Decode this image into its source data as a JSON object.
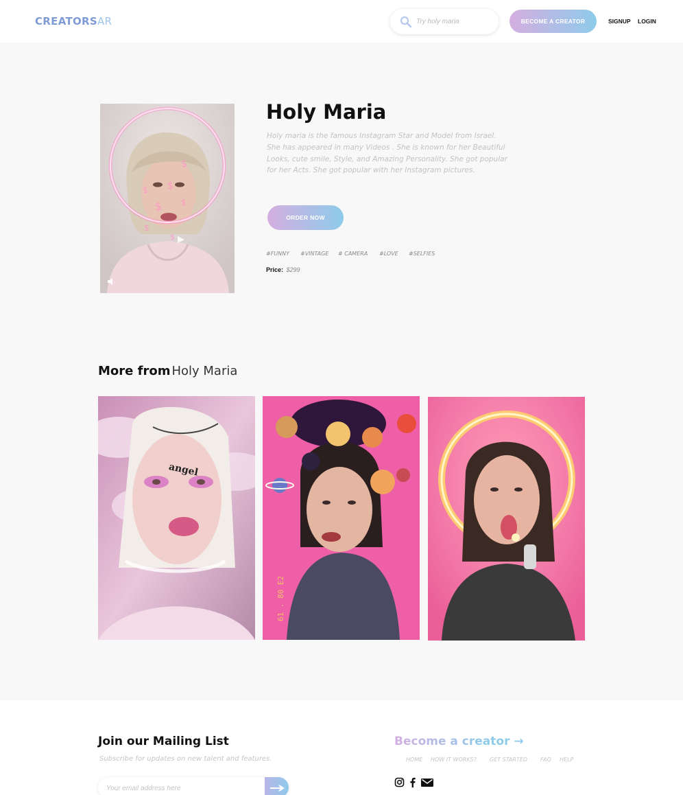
{
  "header": {
    "logo_part1": "CREATORS",
    "logo_part2": "AR",
    "search_placeholder": "Try holy maria",
    "become_creator_label": "BECOME A CREATOR",
    "signup_label": "SIGNUP",
    "login_label": "LOGIN"
  },
  "profile": {
    "name": "Holy Maria",
    "bio": "Holy maria is the famous Instagram Star and Model from Israel. She has appeared in many Videos . She is known for her Beautiful Looks, cute smile, Style, and Amazing Personality. She got popular for her Acts. She got popular with her Instagram pictures.",
    "order_label": "ORDER NOW",
    "tags": [
      "#FUNNY",
      "#VINTAGE",
      "# CAMERA",
      "#LOVE",
      "#SELFIES"
    ],
    "price_label": "Price:",
    "price_value": "$299"
  },
  "more": {
    "title_bold": "More from",
    "title_name": "Holy Maria",
    "card_sticker_text": "angel",
    "card_film_text": "61 . 80 E2"
  },
  "footer": {
    "mailing_title": "Join our Mailing List",
    "mailing_sub": "Subscribe for updates on new talent and features.",
    "email_placeholder": "Your email address here",
    "become_label": "Become a creator →",
    "links": [
      "HOME",
      "HOW IT WORKS?",
      "GET STARTED",
      "FAQ",
      "HELP"
    ]
  },
  "colors": {
    "accent_pink": "#d4aee0",
    "accent_blue": "#8ecbea",
    "logo_blue": "#7f9bd6"
  }
}
